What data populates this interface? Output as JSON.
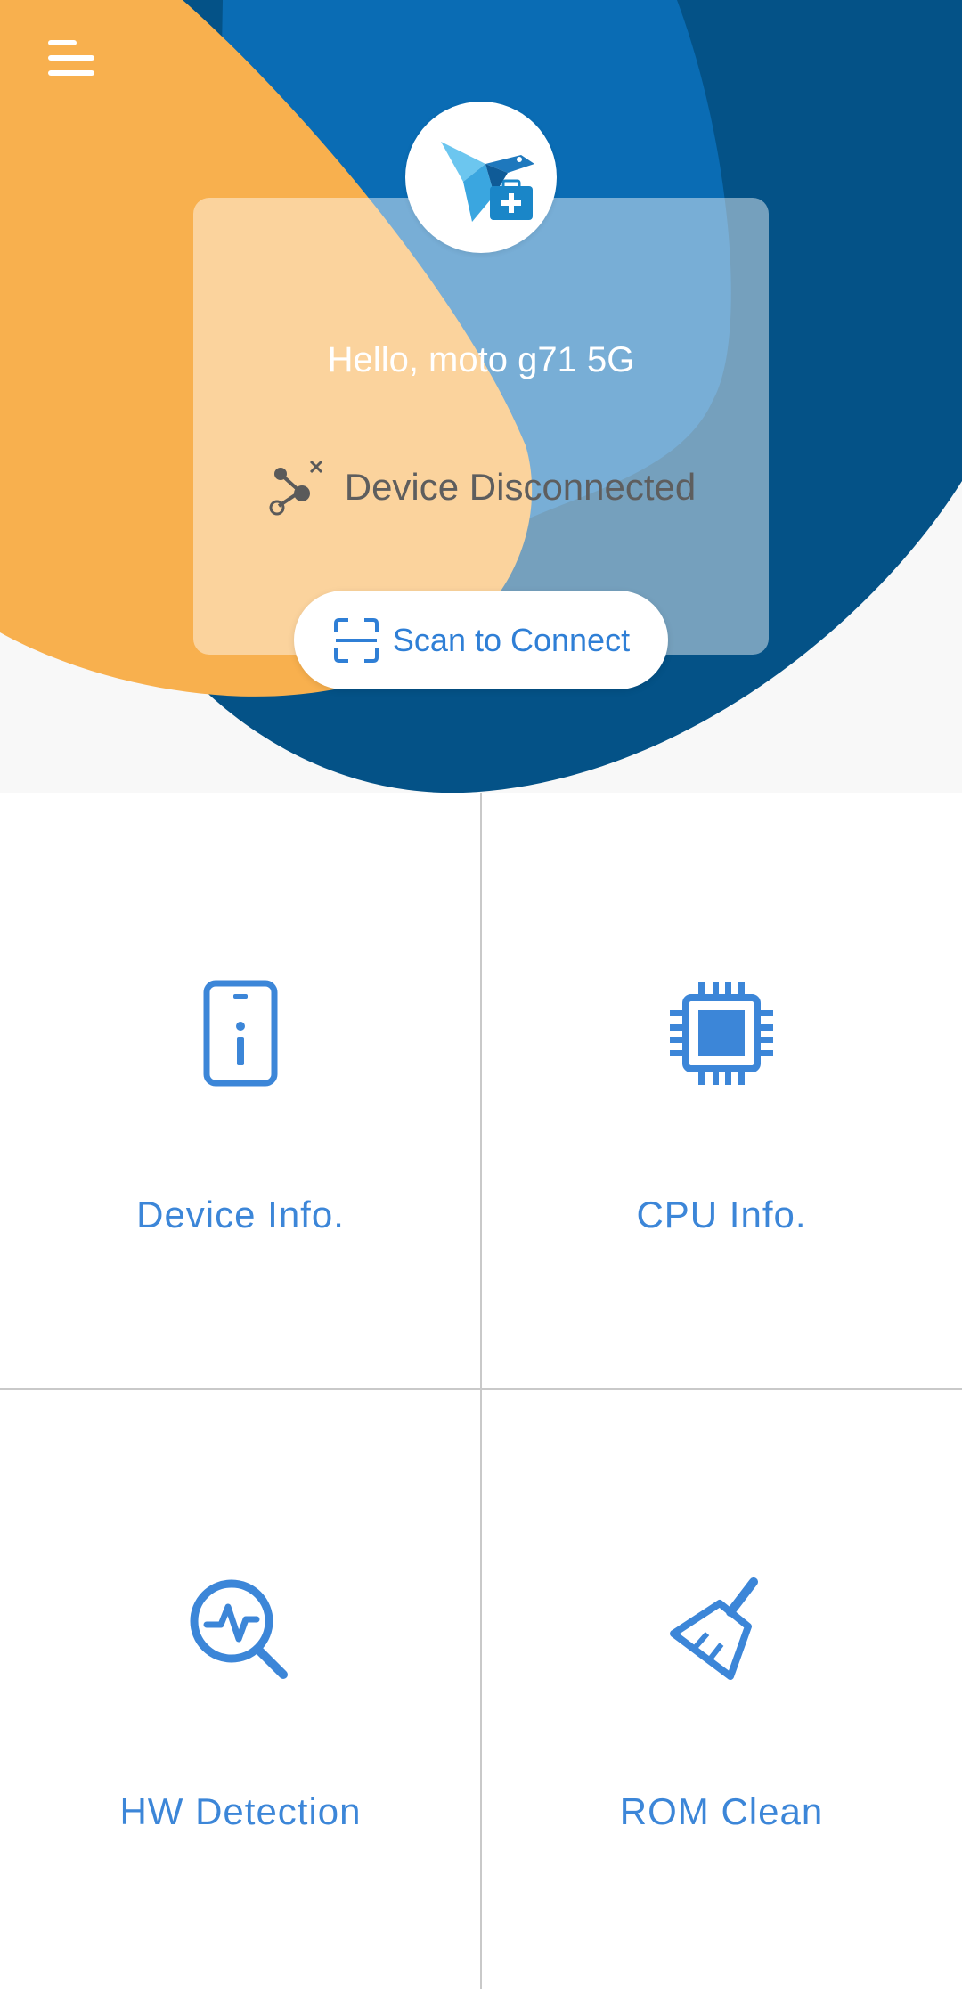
{
  "header": {
    "menu_icon": "hamburger-menu-icon",
    "avatar_icon": "bird-medkit-logo",
    "greeting": "Hello, moto g71 5G",
    "status_icon": "disconnected-nodes-icon",
    "status_text": "Device Disconnected",
    "scan_icon": "scan-frame-icon",
    "scan_label": "Scan to Connect"
  },
  "tiles": [
    {
      "label": "Device Info.",
      "icon": "phone-info-icon"
    },
    {
      "label": "CPU Info.",
      "icon": "cpu-chip-icon"
    },
    {
      "label": "HW Detection",
      "icon": "pulse-search-icon"
    },
    {
      "label": "ROM Clean",
      "icon": "broom-icon"
    }
  ],
  "colors": {
    "orange": "#f8b04e",
    "blue_mid": "#0a6cb4",
    "blue_dark": "#045287",
    "accent": "#3c86d8"
  }
}
